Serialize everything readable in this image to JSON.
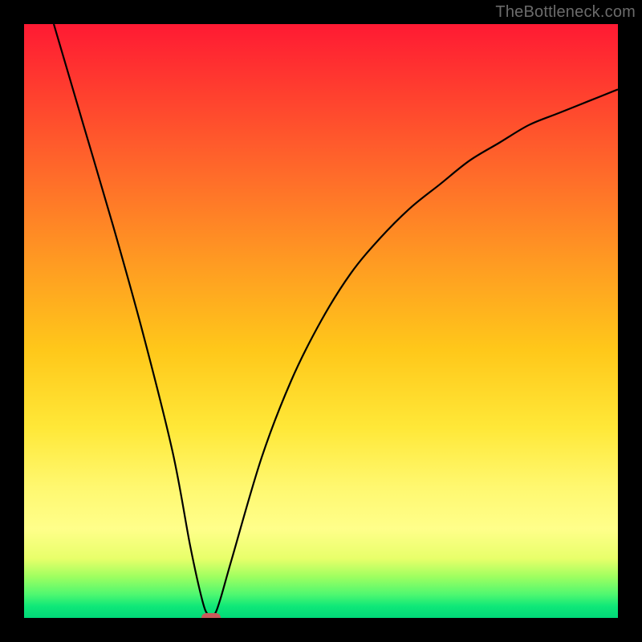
{
  "watermark": "TheBottleneck.com",
  "chart_data": {
    "type": "line",
    "title": "",
    "xlabel": "",
    "ylabel": "",
    "xlim": [
      0,
      100
    ],
    "ylim": [
      0,
      100
    ],
    "grid": false,
    "legend": false,
    "background_gradient": {
      "top_color": "#ff1a33",
      "bottom_color": "#00d878",
      "description": "vertical red-to-green heat gradient (red=high bottleneck, green=optimal)"
    },
    "series": [
      {
        "name": "bottleneck-curve",
        "x": [
          5,
          10,
          15,
          20,
          25,
          28,
          30,
          31,
          32,
          33,
          35,
          40,
          45,
          50,
          55,
          60,
          65,
          70,
          75,
          80,
          85,
          90,
          95,
          100
        ],
        "values": [
          100,
          83,
          66,
          48,
          28,
          12,
          3,
          0.5,
          0.5,
          3,
          10,
          27,
          40,
          50,
          58,
          64,
          69,
          73,
          77,
          80,
          83,
          85,
          87,
          89
        ],
        "color": "#000000"
      }
    ],
    "marker": {
      "x": 31.5,
      "y": 0,
      "color": "#c95a5a",
      "shape": "rounded-pill"
    }
  }
}
